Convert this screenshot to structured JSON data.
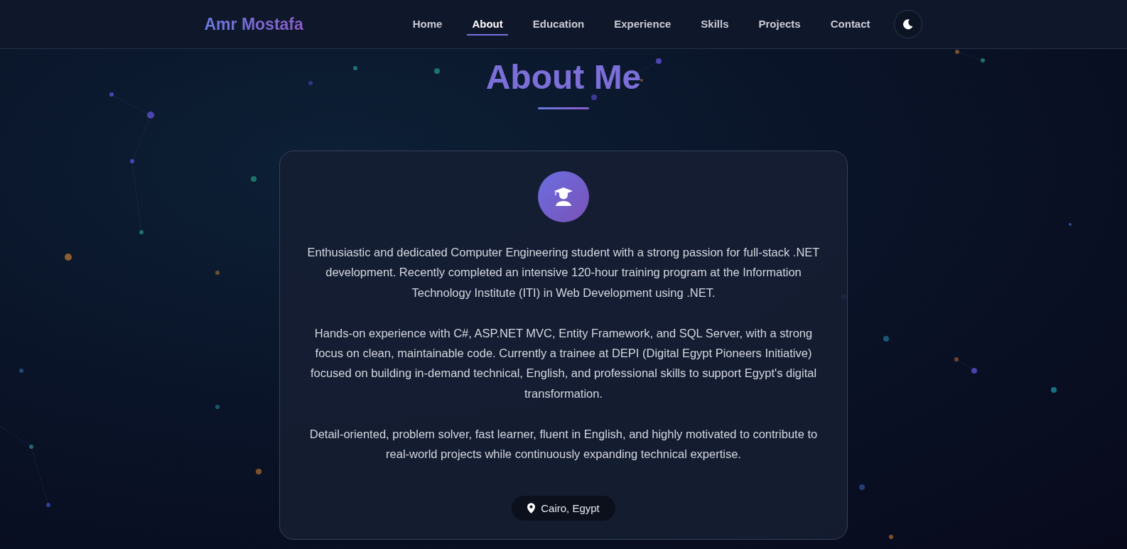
{
  "header": {
    "logo": "Amr Mostafa",
    "nav": [
      {
        "label": "Home",
        "selected": false
      },
      {
        "label": "About",
        "selected": true
      },
      {
        "label": "Education",
        "selected": false
      },
      {
        "label": "Experience",
        "selected": false
      },
      {
        "label": "Skills",
        "selected": false
      },
      {
        "label": "Projects",
        "selected": false
      },
      {
        "label": "Contact",
        "selected": false
      }
    ]
  },
  "section": {
    "title": "About Me",
    "paragraphs": [
      "Enthusiastic and dedicated Computer Engineering student with a strong passion for full-stack .NET development. Recently completed an intensive 120-hour training program at the Information Technology Institute (ITI) in Web Development using .NET.",
      "Hands-on experience with C#, ASP.NET MVC, Entity Framework, and SQL Server, with a strong focus on clean, maintainable code. Currently a trainee at DEPI (Digital Egypt Pioneers Initiative) focused on building in-demand technical, English, and professional skills to support Egypt's digital transformation.",
      "Detail-oriented, problem solver, fast learner, fluent in English, and highly motivated to contribute to real-world projects while continuously expanding technical expertise."
    ],
    "location": "Cairo, Egypt"
  }
}
